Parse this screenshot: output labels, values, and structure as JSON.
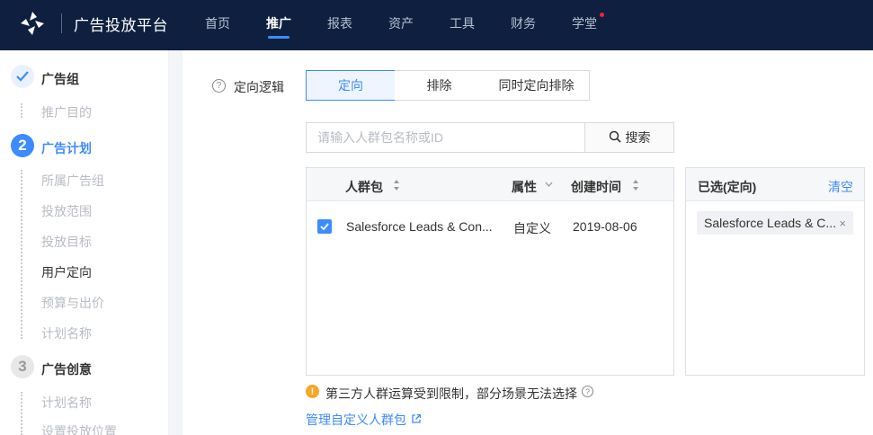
{
  "header": {
    "brand": "广告投放平台",
    "nav": [
      {
        "label": "首页",
        "active": false
      },
      {
        "label": "推广",
        "active": true
      },
      {
        "label": "报表",
        "active": false
      },
      {
        "label": "资产",
        "active": false
      },
      {
        "label": "工具",
        "active": false
      },
      {
        "label": "财务",
        "active": false
      },
      {
        "label": "学堂",
        "active": false,
        "badge_dot": true
      }
    ],
    "accent": "#3e8bff",
    "background": "#0e1f3f"
  },
  "sidebar": {
    "steps": [
      {
        "icon": "check-icon",
        "title": "广告组",
        "status": "done",
        "items": [
          "推广目的"
        ]
      },
      {
        "number": "2",
        "title": "广告计划",
        "status": "current",
        "items": [
          "所属广告组",
          "投放范围",
          "投放目标",
          "用户定向",
          "预算与出价",
          "计划名称"
        ],
        "current_item": "用户定向"
      },
      {
        "number": "3",
        "title": "广告创意",
        "status": "todo",
        "items": [
          "计划名称",
          "设置投放位置"
        ]
      }
    ]
  },
  "targeting": {
    "label": "定向逻辑",
    "options": [
      {
        "label": "定向",
        "active": true
      },
      {
        "label": "排除",
        "active": false
      },
      {
        "label": "同时定向排除",
        "active": false
      }
    ]
  },
  "search": {
    "placeholder": "请输入人群包名称或ID",
    "value": "",
    "button_label": "搜索"
  },
  "table": {
    "columns": [
      "人群包",
      "属性",
      "创建时间"
    ],
    "rows": [
      {
        "checked": true,
        "name": "Salesforce Leads & Con...",
        "attribute": "自定义",
        "created": "2019-08-06"
      }
    ]
  },
  "selected": {
    "title": "已选(定向)",
    "clear_label": "清空",
    "tags": [
      {
        "label": "Salesforce Leads & C...",
        "close": "×"
      }
    ]
  },
  "notice": {
    "icon": "warning-icon",
    "text": "第三方人群运算受到限制，部分场景无法选择"
  },
  "manage_link": "管理自定义人群包"
}
